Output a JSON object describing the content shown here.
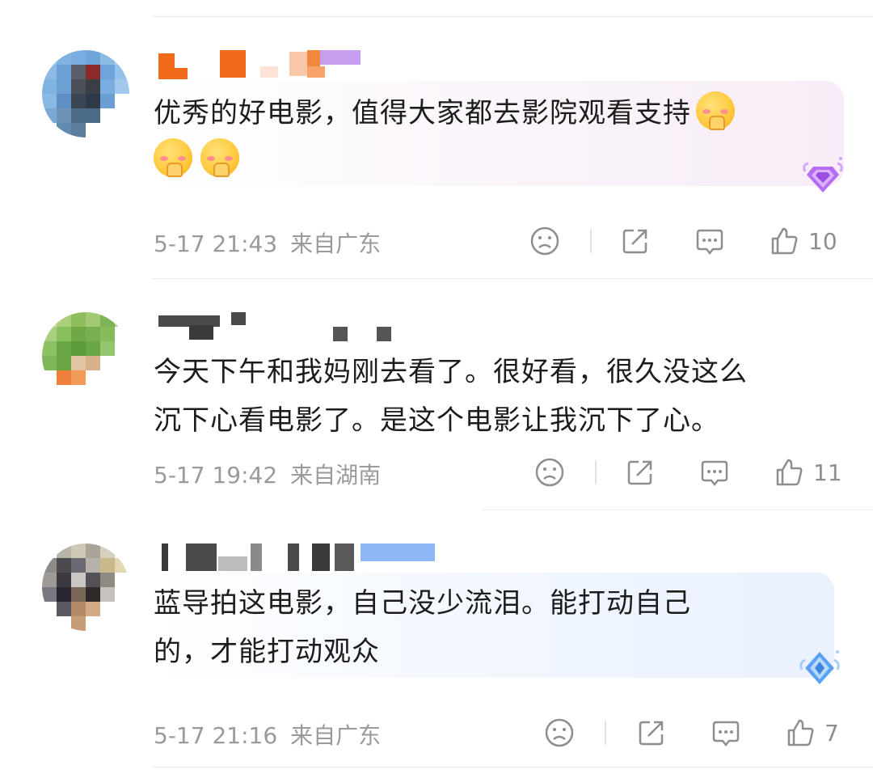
{
  "comments": [
    {
      "text_lines": [
        "优秀的好电影，值得大家都去影院观看支持"
      ],
      "emoji_name": "pray-blush-emoji",
      "time": "5-17 21:43",
      "location": "来自广东",
      "likes": "10",
      "badge_color": "#b56cf0"
    },
    {
      "text_lines": [
        "今天下午和我妈刚去看了。很好看，很久没这么",
        "沉下心看电影了。是这个电影让我沉下了心。"
      ],
      "time": "5-17 19:42",
      "location": "来自湖南",
      "likes": "11"
    },
    {
      "text_lines": [
        "蓝导拍这电影，自己没少流泪。能打动自己",
        "的，才能打动观众"
      ],
      "time": "5-17 21:16",
      "location": "来自广东",
      "likes": "7",
      "badge_color": "#5aa2f5"
    }
  ],
  "icons": {
    "dislike": "sad-face-icon",
    "share": "share-icon",
    "reply": "comment-icon",
    "like": "thumbs-up-icon"
  },
  "colors": {
    "meta_text": "#9a9a9a",
    "body_text": "#1c1c1c",
    "username_orange": "#f26b1d"
  }
}
